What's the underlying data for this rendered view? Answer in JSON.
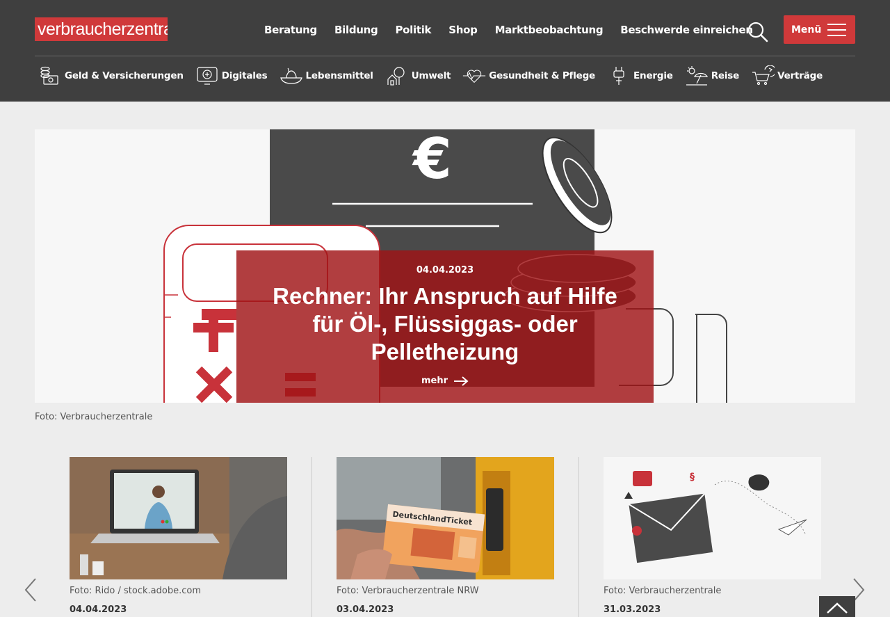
{
  "logo": "verbraucherzentrale",
  "top_nav": [
    "Beratung",
    "Bildung",
    "Politik",
    "Shop",
    "Marktbeobachtung",
    "Beschwerde einreichen"
  ],
  "menu_label": "Menü",
  "categories": [
    {
      "label": "Geld & Versicherungen",
      "icon": "money-icon"
    },
    {
      "label": "Digitales",
      "icon": "digital-icon"
    },
    {
      "label": "Lebensmittel",
      "icon": "food-icon"
    },
    {
      "label": "Umwelt",
      "icon": "environment-icon"
    },
    {
      "label": "Gesundheit & Pflege",
      "icon": "health-icon"
    },
    {
      "label": "Energie",
      "icon": "energy-icon"
    },
    {
      "label": "Reise",
      "icon": "travel-icon"
    },
    {
      "label": "Verträge",
      "icon": "contracts-icon"
    }
  ],
  "hero": {
    "date": "04.04.2023",
    "title": "Rechner: Ihr Anspruch auf Hilfe für Öl-, Flüssiggas- oder Pelletheizung",
    "more": "mehr",
    "caption": "Foto: Verbraucherzentrale"
  },
  "teasers": [
    {
      "caption": "Foto: Rido / stock.adobe.com",
      "date": "04.04.2023"
    },
    {
      "caption": "Foto: Verbraucherzentrale NRW",
      "date": "03.04.2023",
      "ticket_text": "DeutschlandTicket"
    },
    {
      "caption": "Foto: Verbraucherzentrale",
      "date": "31.03.2023"
    }
  ],
  "colors": {
    "brand": "#d0393a",
    "header": "#3f3f3f",
    "overlay": "#a01416"
  }
}
